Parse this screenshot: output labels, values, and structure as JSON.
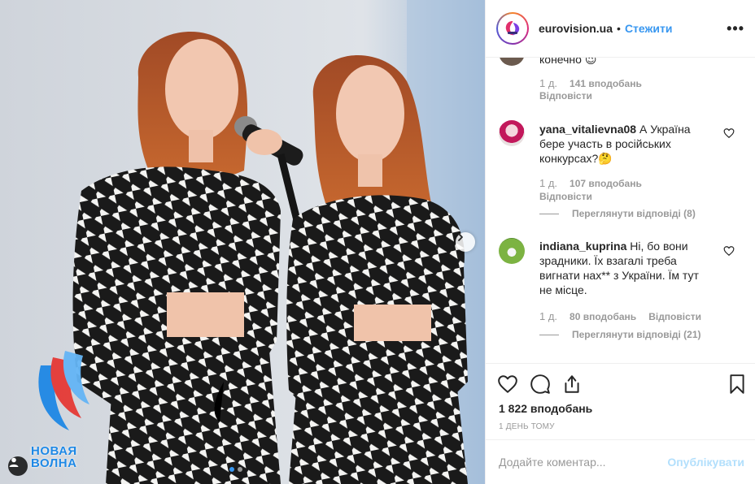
{
  "post": {
    "username": "eurovision.ua",
    "separator": "•",
    "follow_label": "Стежити",
    "more_icon": "•••",
    "photo": {
      "watermark_line1": "НОВАЯ",
      "watermark_line2": "ВОЛНА",
      "carousel_total": 2,
      "carousel_active": 1
    }
  },
  "comments": [
    {
      "text_tail": "конечно",
      "emoji": "😉",
      "age": "1 д.",
      "likes": "141 вподобань",
      "reply_label": "Відповісти"
    },
    {
      "username": "yana_vitalievna08",
      "text": "А Україна бере участь в російських конкурсах?🤔",
      "age": "1 д.",
      "likes": "107 вподобань",
      "reply_label": "Відповісти",
      "view_replies": "Переглянути відповіді (8)"
    },
    {
      "username": "indiana_kuprina",
      "text": "Ні, бо вони зрадники. Їх взагалі треба вигнати нах** з України. Їм тут не місце.",
      "age": "1 д.",
      "likes": "80 вподобань",
      "reply_label": "Відповісти",
      "view_replies": "Переглянути відповіді (21)"
    }
  ],
  "actions": {
    "like_icon": "heart-icon",
    "comment_icon": "comment-icon",
    "share_icon": "share-icon",
    "save_icon": "bookmark-icon"
  },
  "likes_total": "1 822 вподобань",
  "time_ago": "1 ДЕНЬ ТОМУ",
  "add_comment": {
    "placeholder": "Додайте коментар...",
    "publish_label": "Опублікувати"
  },
  "colors": {
    "link_blue": "#3897f0",
    "publish_disabled": "#b2dffc",
    "muted": "#999999"
  }
}
